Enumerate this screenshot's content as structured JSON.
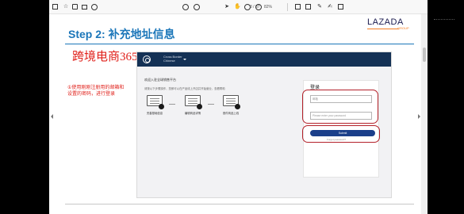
{
  "toolbar": {
    "page_indicator": "3 / 37",
    "zoom": "82%"
  },
  "slide": {
    "title": "Step 2: 补充地址信息",
    "logo_text": "LAZADA",
    "logo_subtext": "GROUP",
    "watermark": "跨境电商365",
    "note": "①使用刚刚注册用的邮箱和设置的密码，进行登录"
  },
  "web": {
    "brand_line1": "Cross Border",
    "brand_line2": "Chinese",
    "main_title": "欢迎入驻全球销售平台",
    "main_subtitle": "请按以下步骤操作，您即可以在产品线上开店并开始营业，查看帮助",
    "steps": [
      {
        "label": "完善基础信息"
      },
      {
        "label": "编辑商品详情"
      },
      {
        "label": "首件商品上线"
      }
    ],
    "login": {
      "title": "登录",
      "email_placeholder": "邮箱",
      "password_placeholder": "Please enter your password",
      "submit_label": "Submit",
      "forgot_label": "Forgot password?"
    }
  },
  "colors": {
    "title_blue": "#1b76b9",
    "annotation_red": "#e0201a",
    "header_navy": "#143155",
    "button_blue": "#1b3f8a",
    "highlight_red": "#b3212a"
  },
  "icons": [
    "home-icon",
    "star-icon",
    "print-icon",
    "email-icon",
    "search-icon",
    "arrow-up-icon",
    "arrow-down-icon",
    "cursor-icon",
    "hand-icon",
    "zoom-out-icon",
    "zoom-in-icon",
    "comment-icon",
    "pen-icon",
    "share-icon"
  ]
}
